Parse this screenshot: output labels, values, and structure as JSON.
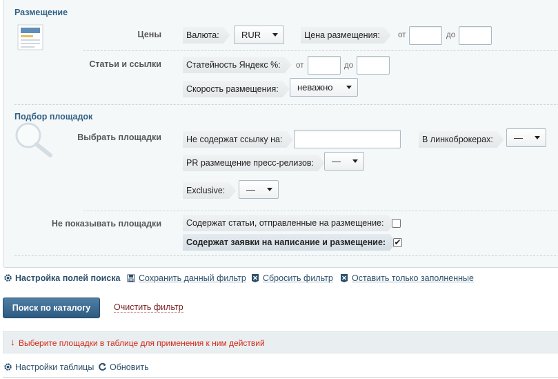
{
  "placement": {
    "title": "Размещение",
    "prices": {
      "label": "Цены",
      "currency_tag": "Валюта:",
      "currency_value": "RUR",
      "price_tag": "Цена размещения:",
      "from": "от",
      "to": "до",
      "from_value": "",
      "to_value": ""
    },
    "articles": {
      "label": "Статьи и ссылки",
      "yandex_tag": "Статейность Яндекс %:",
      "from": "от",
      "to": "до",
      "from_value": "",
      "to_value": "",
      "speed_tag": "Скорость размещения:",
      "speed_value": "неважно"
    }
  },
  "selection": {
    "title": "Подбор площадок",
    "choose": {
      "label": "Выбрать площадки",
      "no_link_tag": "Не содержат ссылку на:",
      "no_link_value": "",
      "brokers_tag": "В линкоброкерах:",
      "brokers_value": "—",
      "pr_tag": "PR размещение пресс-релизов:",
      "pr_value": "—",
      "exclusive_tag": "Exclusive:",
      "exclusive_value": "—"
    },
    "hide": {
      "label": "Не показывать площадки",
      "articles_tag": "Содержат статьи, отправленные на размещение:",
      "articles_checked": false,
      "orders_tag": "Содержат заявки на написание и размещение:",
      "orders_checked": true,
      "check_mark": "✔"
    }
  },
  "actions": {
    "configure": "Настройка полей поиска",
    "save": "Сохранить данный фильтр",
    "reset": "Сбросить фильтр",
    "keep_filled": "Оставить только заполненные"
  },
  "search_button": "Поиск по каталогу",
  "clear_filter": "Очистить фильтр",
  "notice": {
    "arrow": "↓",
    "text": "Выберите площадки в таблице для применения к ним действий"
  },
  "table_tools": {
    "settings": "Настройки таблицы",
    "refresh": "Обновить"
  },
  "colors": {
    "accent": "#2f5f84",
    "button": "#3d6b91",
    "notice_text": "#d42a17",
    "clear_link": "#7a1f1f"
  }
}
